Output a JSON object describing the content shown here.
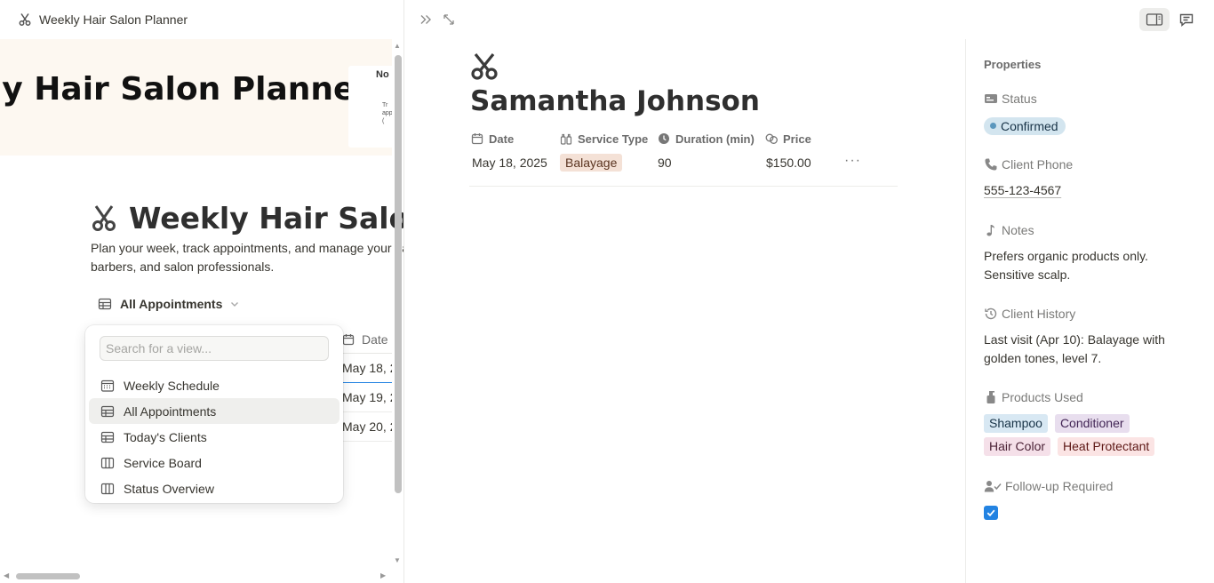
{
  "window": {
    "title": "Weekly Hair Salon Planner"
  },
  "left_page": {
    "cover_title": "kly Hair Salon Planner",
    "cover_card_title": "No",
    "cover_card_text": [
      "Tr",
      "app",
      "("
    ],
    "title": "Weekly Hair Salon P",
    "description": "Plan your week, track appointments, and manage your hair stylists, barbers, and salon professionals.",
    "current_view": "All Appointments",
    "table_peek": {
      "header": "Date",
      "rows": [
        "May 18, 2",
        "May 19, 2",
        "May 20, 2"
      ]
    }
  },
  "view_popover": {
    "search_placeholder": "Search for a view...",
    "items": [
      {
        "label": "Weekly Schedule",
        "icon": "calendar-icon",
        "active": false
      },
      {
        "label": "All Appointments",
        "icon": "table-icon",
        "active": true
      },
      {
        "label": "Today's Clients",
        "icon": "table-icon",
        "active": false
      },
      {
        "label": "Service Board",
        "icon": "board-icon",
        "active": false
      },
      {
        "label": "Status Overview",
        "icon": "board-icon",
        "active": false
      }
    ]
  },
  "record": {
    "title": "Samantha Johnson",
    "icon": "scissors-icon",
    "columns": {
      "date": {
        "label": "Date",
        "value": "May 18, 2025"
      },
      "service_type": {
        "label": "Service Type",
        "value": "Balayage",
        "tag_bg": "#f4e1d6",
        "tag_fg": "#5a3420"
      },
      "duration": {
        "label": "Duration (min)",
        "value": "90"
      },
      "price": {
        "label": "Price",
        "value": "$150.00"
      }
    },
    "more_label": "···"
  },
  "properties": {
    "heading": "Properties",
    "status": {
      "label": "Status",
      "value": "Confirmed"
    },
    "client_phone": {
      "label": "Client Phone",
      "value": "555-123-4567"
    },
    "notes": {
      "label": "Notes",
      "value": "Prefers organic products only. Sensitive scalp."
    },
    "client_history": {
      "label": "Client History",
      "value": "Last visit (Apr 10): Balayage with golden tones, level 7."
    },
    "products_used": {
      "label": "Products Used",
      "items": [
        {
          "name": "Shampoo",
          "bg": "#d8e8f3",
          "fg": "#183347"
        },
        {
          "name": "Conditioner",
          "bg": "#e8deee",
          "fg": "#412454"
        },
        {
          "name": "Hair Color",
          "bg": "#f5e0e9",
          "fg": "#4c2337"
        },
        {
          "name": "Heat Protectant",
          "bg": "#fbe4e4",
          "fg": "#5d1715"
        }
      ]
    },
    "followup": {
      "label": "Follow-up Required",
      "checked": true
    }
  },
  "colors": {
    "accent_blue": "#2383e2",
    "status_pill_bg": "#d3e5ef",
    "cover_bg": "#fdf8f1"
  }
}
